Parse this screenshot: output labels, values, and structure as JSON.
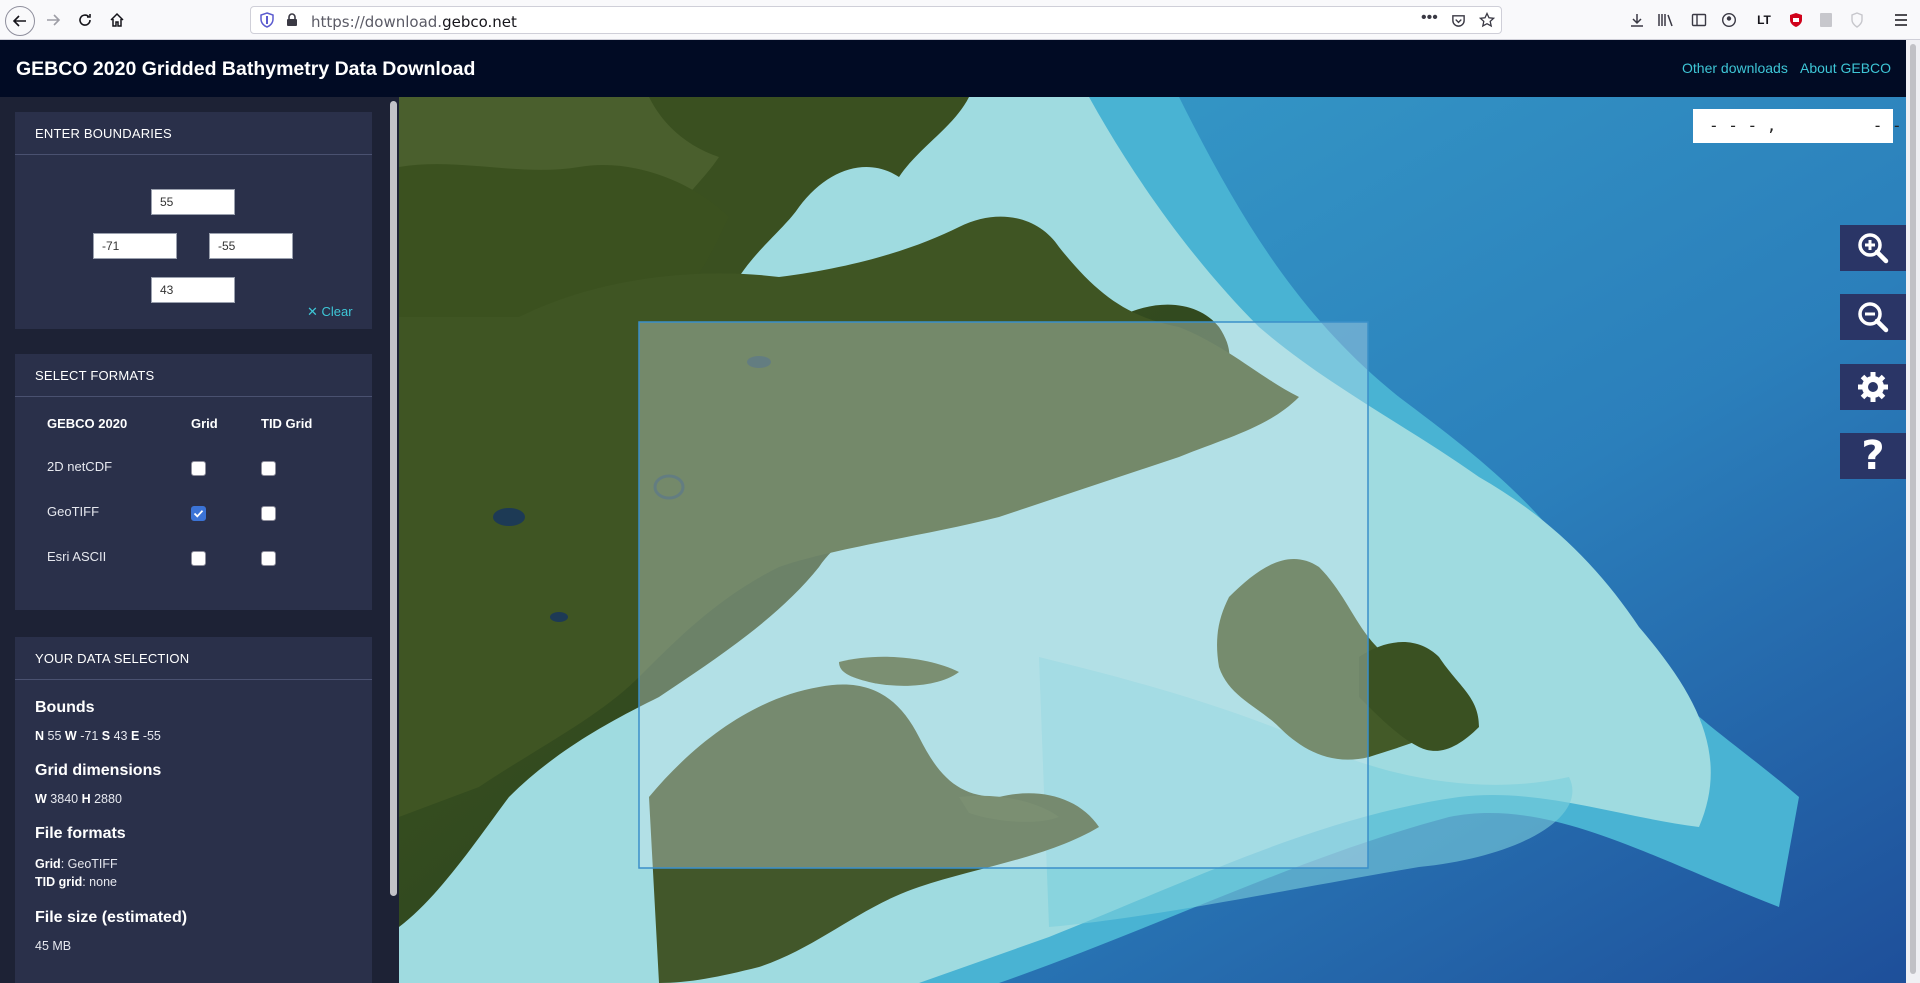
{
  "browser": {
    "url_prefix": "https://download.",
    "url_domain": "gebco.net"
  },
  "header": {
    "title": "GEBCO 2020 Gridded Bathymetry Data Download",
    "links": [
      "Other downloads",
      "About GEBCO"
    ]
  },
  "boundaries": {
    "title": "ENTER BOUNDARIES",
    "north": "55",
    "west": "-71",
    "east": "-55",
    "south": "43",
    "clear_label": "Clear"
  },
  "formats": {
    "title": "SELECT FORMATS",
    "headers": [
      "GEBCO 2020",
      "Grid",
      "TID Grid"
    ],
    "rows": [
      {
        "label": "2D netCDF",
        "grid": false,
        "tid": false
      },
      {
        "label": "GeoTIFF",
        "grid": true,
        "tid": false
      },
      {
        "label": "Esri ASCII",
        "grid": false,
        "tid": false
      }
    ]
  },
  "selection": {
    "title": "YOUR DATA SELECTION",
    "bounds_heading": "Bounds",
    "bounds": {
      "n_label": "N",
      "n": "55",
      "w_label": "W",
      "w": "-71",
      "s_label": "S",
      "s": "43",
      "e_label": "E",
      "e": "-55"
    },
    "grid_heading": "Grid dimensions",
    "grid": {
      "w_label": "W",
      "w": "3840",
      "h_label": "H",
      "h": "2880"
    },
    "formats_heading": "File formats",
    "grid_format_label": "Grid",
    "grid_format": ": GeoTIFF",
    "tid_format_label": "TID grid",
    "tid_format": ": none",
    "size_heading": "File size (estimated)",
    "size": "45 MB"
  },
  "map": {
    "coord_readout": "- - - ,          - - -"
  },
  "colors": {
    "header_bg": "#010b24",
    "sidebar_bg": "#1d2235",
    "panel_bg": "#2a304a",
    "accent": "#3ec6d6",
    "map_button_bg": "#2a3566"
  },
  "icons": [
    "back-arrow-icon",
    "forward-arrow-icon",
    "reload-icon",
    "home-icon",
    "shield-icon",
    "lock-icon",
    "more-icon",
    "pocket-icon",
    "bookmark-star-icon",
    "download-icon",
    "library-icon",
    "sidebar-icon",
    "account-icon",
    "extension-icon",
    "ublock-icon",
    "reader-icon",
    "shield-outline-icon",
    "menu-icon",
    "zoom-in-icon",
    "zoom-out-icon",
    "gear-icon",
    "question-icon",
    "clear-x-icon"
  ]
}
